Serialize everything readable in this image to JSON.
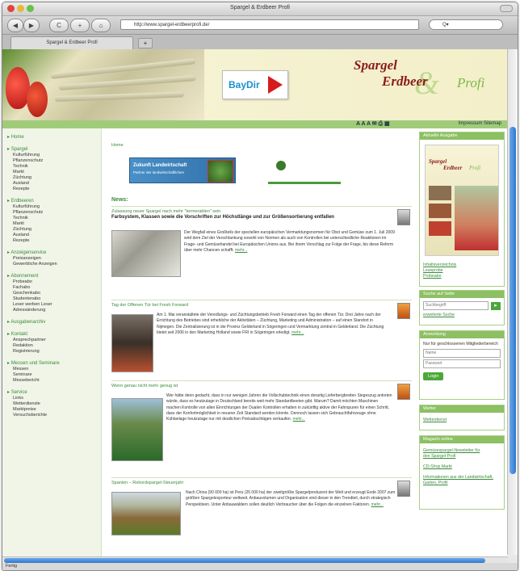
{
  "window": {
    "title": "Spargel & Erdbeer Profi"
  },
  "toolbar": {
    "back": "◀",
    "forward": "▶",
    "reload": "C",
    "add": "+",
    "home": "⌂",
    "url": "http://www.spargel-erdbeerprofi.de/",
    "search_placeholder": "Q▾"
  },
  "tabbar": {
    "tab_label": "Spargel & Erdbeer Profi",
    "new_tab": "+"
  },
  "header": {
    "logo_word1": "Spargel",
    "logo_word2": "Erdbeer",
    "logo_word3": "Profi",
    "logo_amp": "&",
    "baydir": "BayDir"
  },
  "util": {
    "sizes": "A A A ✉ ⎙ ▦",
    "links": "Impressum  Sitemap"
  },
  "leftnav": [
    {
      "head": "Home",
      "items": []
    },
    {
      "head": "Spargel",
      "items": [
        "Kulturführung",
        "Pflanzenschutz",
        "Technik",
        "Markt",
        "Züchtung",
        "Ausland",
        "Rezepte"
      ]
    },
    {
      "head": "Erdbeeren",
      "items": [
        "Kulturführung",
        "Pflanzenschutz",
        "Technik",
        "Markt",
        "Züchtung",
        "Ausland",
        "Rezepte"
      ]
    },
    {
      "head": "Anzeigenservice",
      "items": [
        "Preisanzeigen",
        "Gewerbliche Anzeigen"
      ]
    },
    {
      "head": "Abonnement",
      "items": [
        "Probeabo",
        "Fachabo",
        "Geschenkabo",
        "Studentenabo",
        "Leser werben Leser",
        "Adressänderung"
      ]
    },
    {
      "head": "Ausgabenarchiv",
      "items": []
    },
    {
      "head": "Kontakt",
      "items": [
        "Ansprechpartner",
        "Redaktion",
        "Registrierung"
      ]
    },
    {
      "head": "Messen und Seminare",
      "items": [
        "Messen",
        "Seminare",
        "Messebericht"
      ]
    },
    {
      "head": "Service",
      "items": [
        "Links",
        "Wetterdienste",
        "Marktpreise",
        "Versuchsberichte"
      ]
    }
  ],
  "main": {
    "breadcrumb": "Home",
    "banner1_title": "Zukunft Landwirtschaft",
    "banner1_sub": "Partner der landwirtschaftlichen",
    "news_heading": "News:",
    "articles": [
      {
        "kicker": "Zulassung neuer Spargel nach mehr \"termerablen\" sein",
        "headline": "Farbsystem, Klassen sowie die Vorschriften zur Höchstlänge und zur Größensortierung entfallen",
        "body": "Der Wegfall eines Großteils der speziellen europäischen Vermarktungsnormen für Obst und Gemüse zum 1. Juli 2009 wird dem Ziel der Verschlankung sowohl von Normen als auch von Kontrollen bei unterschiedliche Reaktionen im Frage- und Gemüsehandel bei Europäischen Unions aus. Bei ihrem Vorschlag zur Folge der Frage, bis diese Reform über mehr Chancen schafft.",
        "more": "mehr..."
      },
      {
        "kicker": "Tag der Offenen Tür bei Fresh Forward",
        "headline": "",
        "body": "Am 1. Mai veranstaltete der Veredlungs- und Züchtungsbetrieb Fresh Forward einen Tag der offenen Tür. Drei Jahre nach der Errichtung des Betriebes sind erhebliche der Aktivitäten – Züchtung, Marketing und Administration – auf einen Standort in Nijmegen. Die Zentralisierung ist in die Provinz Gelderland in Sögeringen und Vermarktung zentral in Gelderland. Die Züchtung bietet seit 2006 in den Marketing Holland sowie FRI in Sögeringen erledigt.",
        "more": "mehr..."
      },
      {
        "kicker": "Wenn genau nicht mehr genug ist",
        "headline": "",
        "body": "Wer hätte denn gedacht, dass in nur wenigen Jahren die Vollschubtechnik einen derartig Lieferbergbreiten Siegeszug antreten würde, dass es heutzutage in Deutschland bereits weit mehr Standardbeeten gibt. Warum? Damit möchten Maschinen machen Kontrolle von allen Einrichtungen der Dualen Kontrollen erhalten in zukünftig aktive der Fahrspuren für einen Schritt, dass der Konfortmöglichkeit in neuerer Zeit Standard werden könnte. Dennoch lassen sich Gebrauchtfahrzeuge ohne Kühlanlage heutzutage nur mit deutlichen Preisabschlägen verkaufen.",
        "more": "mehr..."
      },
      {
        "kicker": "Spanien – Rekordspargel-Steuerjahr",
        "headline": "",
        "body": "Nach China (90 000 ha) ist Peru (25 000 ha) der zweitgrößte Spargelproduzent der Welt und erzeugt Ende 2007 zum größten Spargelexporteur weltweit. Anbauvolumen und Organisation sind dieser in den Trendteil, durch strategisch Perspektiven. Unter Anbauwäldern sollen deutlich Verbraucher über die Folgen die einzelnen Faktoren.",
        "more": "mehr..."
      }
    ]
  },
  "right": {
    "box1_head": "Aktuelle Ausgabe",
    "box1_links": [
      "Inhaltsverzeichnis",
      "Leseprobe",
      "Probeabo"
    ],
    "search_head": "Suche auf Seite",
    "search_placeholder": "Suchbegriff",
    "search_go": "▸",
    "search_adv": "erweiterte Suche",
    "login_head": "Anmeldung",
    "login_text": "Nur für geschlossenen Mitgliederbereich",
    "login_user": "Name",
    "login_pass": "Passwort",
    "login_btn": "Login",
    "box4_head": "Wetter",
    "box4_link": "Wetterdienst",
    "box5_head": "Magazin online",
    "box5_links": [
      "Gemüsespargel-Newsletter für den Spargel-Profi",
      "CD-Shop Markt",
      "Informationen aus der Landwirtschaft, Garten, Profil"
    ]
  },
  "statusbar": {
    "text": "Fertig"
  }
}
